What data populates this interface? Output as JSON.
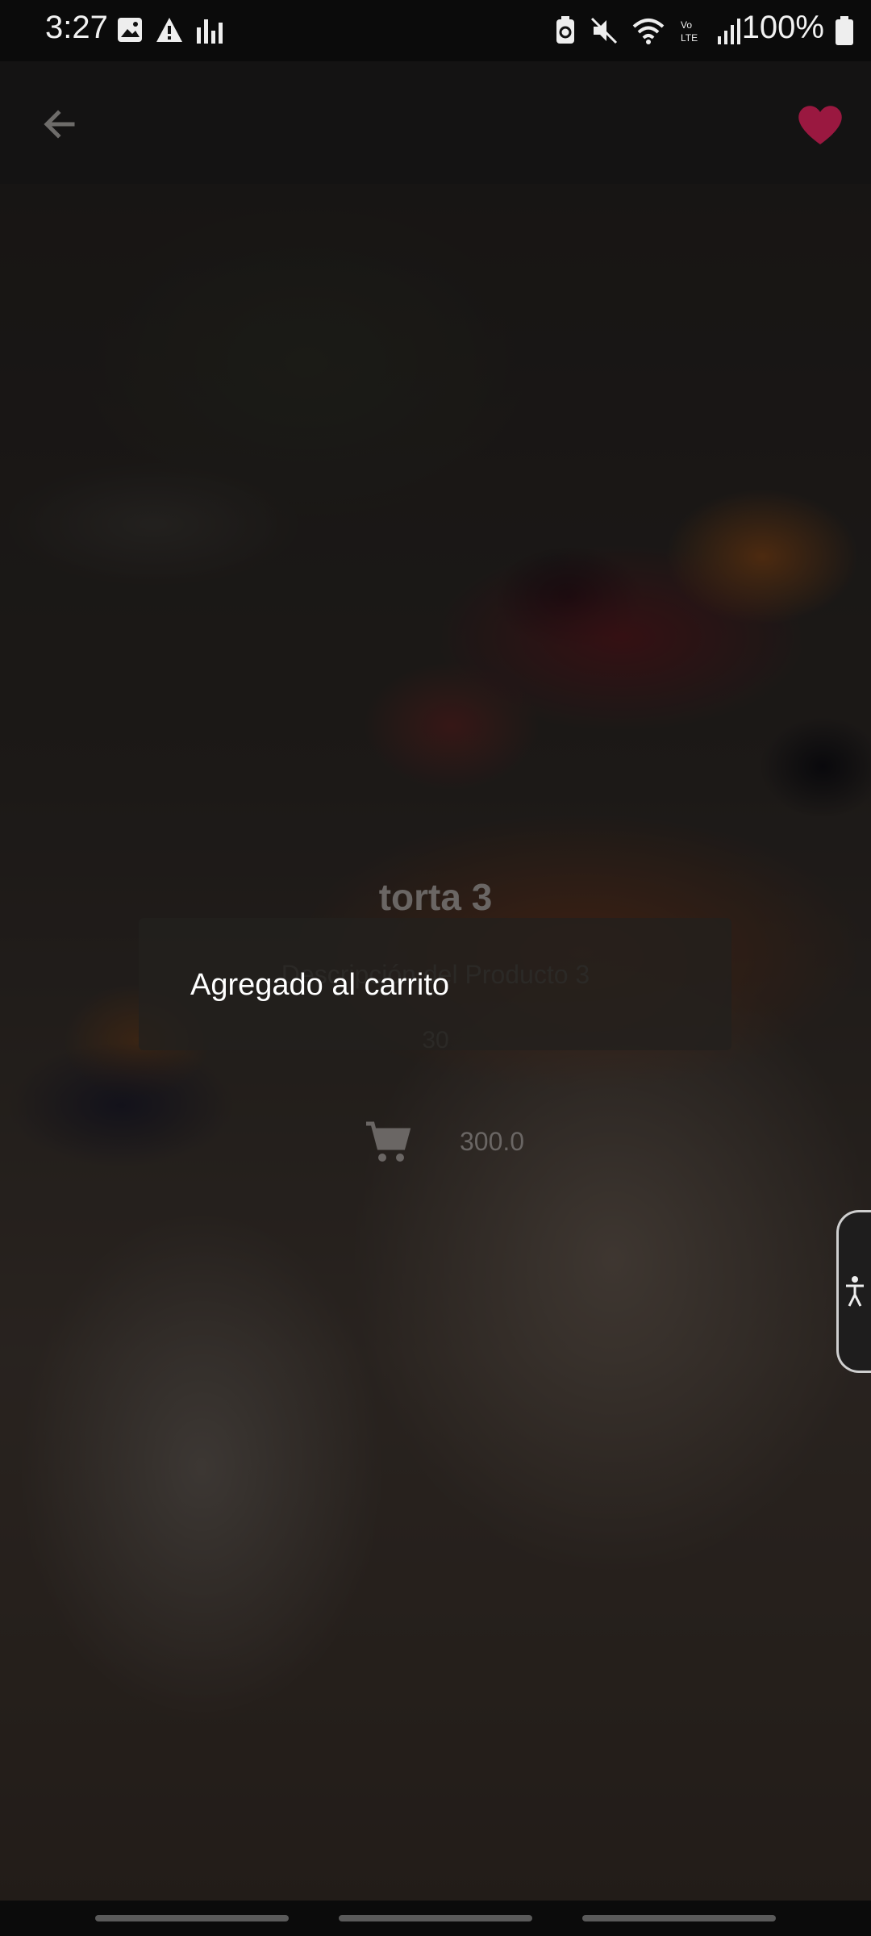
{
  "status_bar": {
    "time": "3:27",
    "battery": "100%"
  },
  "app_bar": {
    "back_icon": "arrow-left-icon",
    "favorite_icon": "heart-icon",
    "favorite_color": "#9a1840"
  },
  "product": {
    "title": "torta 3",
    "description": "Descripción del Producto 3",
    "quantity": "30",
    "price": "300.0",
    "cart_icon": "cart-icon"
  },
  "toast": {
    "message": "Agregado al carrito"
  },
  "accessibility": {
    "icon": "accessibility-icon"
  }
}
